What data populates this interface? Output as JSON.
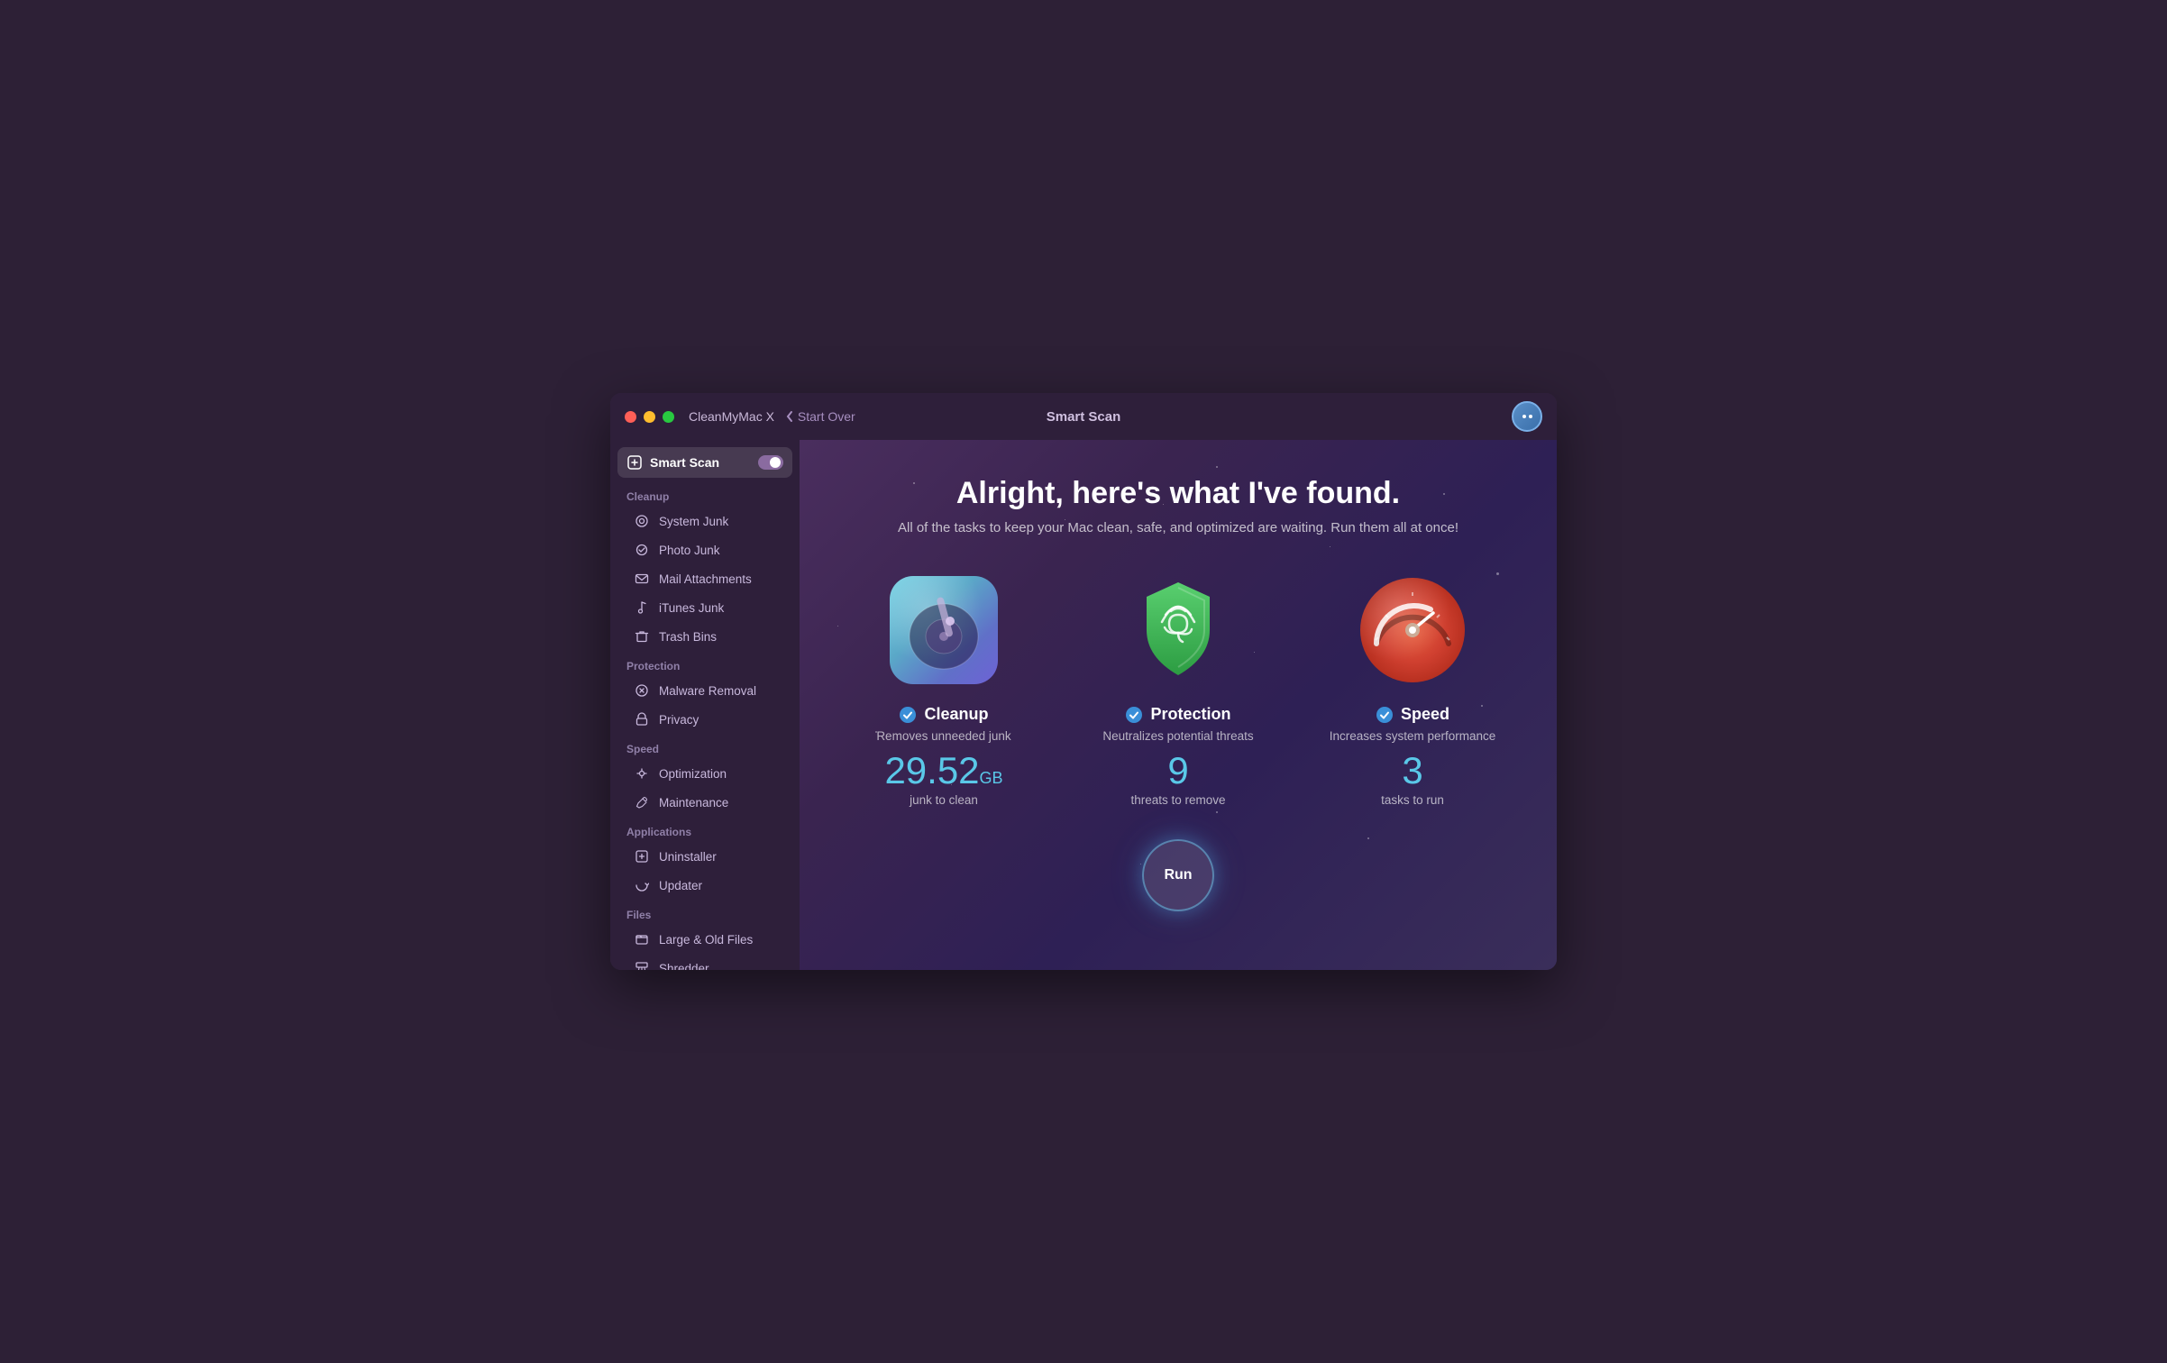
{
  "window": {
    "app_name": "CleanMyMac X",
    "nav_back": "Start Over",
    "title": "Smart Scan"
  },
  "sidebar": {
    "active_item_label": "Smart Scan",
    "sections": [
      {
        "label": "Cleanup",
        "items": [
          {
            "id": "system-junk",
            "label": "System Junk",
            "icon": "system-junk-icon"
          },
          {
            "id": "photo-junk",
            "label": "Photo Junk",
            "icon": "photo-junk-icon"
          },
          {
            "id": "mail-attachments",
            "label": "Mail Attachments",
            "icon": "mail-icon"
          },
          {
            "id": "itunes-junk",
            "label": "iTunes Junk",
            "icon": "itunes-icon"
          },
          {
            "id": "trash-bins",
            "label": "Trash Bins",
            "icon": "trash-icon"
          }
        ]
      },
      {
        "label": "Protection",
        "items": [
          {
            "id": "malware-removal",
            "label": "Malware Removal",
            "icon": "malware-icon"
          },
          {
            "id": "privacy",
            "label": "Privacy",
            "icon": "privacy-icon"
          }
        ]
      },
      {
        "label": "Speed",
        "items": [
          {
            "id": "optimization",
            "label": "Optimization",
            "icon": "optimization-icon"
          },
          {
            "id": "maintenance",
            "label": "Maintenance",
            "icon": "maintenance-icon"
          }
        ]
      },
      {
        "label": "Applications",
        "items": [
          {
            "id": "uninstaller",
            "label": "Uninstaller",
            "icon": "uninstaller-icon"
          },
          {
            "id": "updater",
            "label": "Updater",
            "icon": "updater-icon"
          }
        ]
      },
      {
        "label": "Files",
        "items": [
          {
            "id": "large-old-files",
            "label": "Large & Old Files",
            "icon": "files-icon"
          },
          {
            "id": "shredder",
            "label": "Shredder",
            "icon": "shredder-icon"
          }
        ]
      }
    ]
  },
  "main": {
    "heading": "Alright, here's what I've found.",
    "subheading": "All of the tasks to keep your Mac clean, safe, and optimized are waiting. Run them all at once!",
    "cards": [
      {
        "id": "cleanup",
        "title": "Cleanup",
        "description": "Removes unneeded junk",
        "value": "29.52",
        "unit": "GB",
        "value_label": "junk to clean"
      },
      {
        "id": "protection",
        "title": "Protection",
        "description": "Neutralizes potential threats",
        "value": "9",
        "unit": "",
        "value_label": "threats to remove"
      },
      {
        "id": "speed",
        "title": "Speed",
        "description": "Increases system performance",
        "value": "3",
        "unit": "",
        "value_label": "tasks to run"
      }
    ],
    "run_button": "Run"
  }
}
